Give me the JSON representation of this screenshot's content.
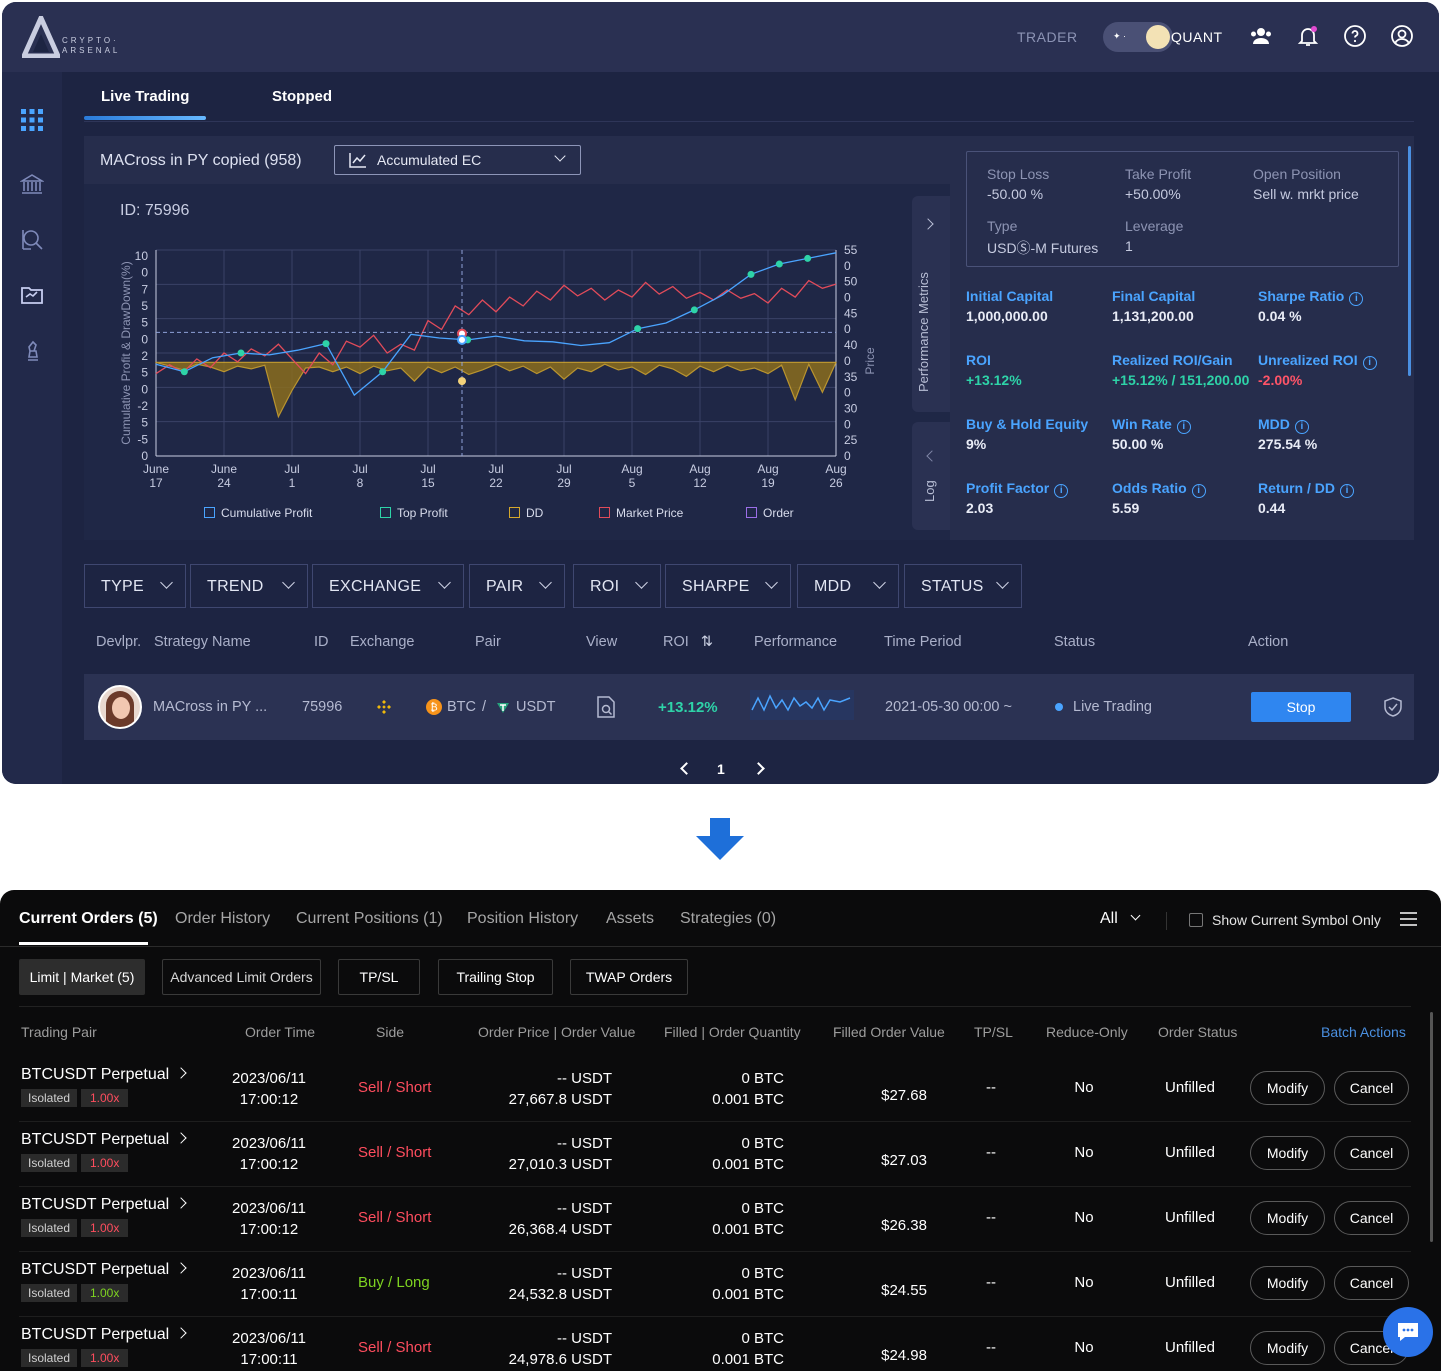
{
  "app": {
    "logo_line1": "CRYPTO·",
    "logo_line2": "ARSENAL",
    "mode_left": "TRADER",
    "mode_right": "QUANT"
  },
  "tabs": [
    "Live Trading",
    "Stopped"
  ],
  "chart_panel": {
    "strategy_title": "MACross in PY copied (958)",
    "view_select": "Accumulated EC",
    "id_label": "ID: 75996",
    "side_tab_metrics": "Performance Metrics",
    "side_tab_log": "Log"
  },
  "chart_data": {
    "type": "line",
    "ylabel": "Cumulative Profit & DrawDown(%)",
    "y2label": "Price",
    "left_ticks": [
      "10",
      "0",
      "7",
      "5",
      "5",
      "0",
      "2",
      "5",
      "0",
      "-2",
      "5",
      "-5",
      "0"
    ],
    "right_ticks": [
      "55",
      "0",
      "50",
      "0",
      "45",
      "0",
      "40",
      "0",
      "35",
      "0",
      "30",
      "0",
      "25",
      "0"
    ],
    "x_ticks": [
      [
        "June",
        "17"
      ],
      [
        "June",
        "24"
      ],
      [
        "Jul",
        "1"
      ],
      [
        "Jul",
        "8"
      ],
      [
        "Jul",
        "15"
      ],
      [
        "Jul",
        "22"
      ],
      [
        "Jul",
        "29"
      ],
      [
        "Aug",
        "5"
      ],
      [
        "Aug",
        "12"
      ],
      [
        "Aug",
        "19"
      ],
      [
        "Aug",
        "26"
      ]
    ],
    "legend": [
      "Cumulative Profit",
      "Top Profit",
      "DD",
      "Market Price",
      "Order"
    ],
    "cumulative_profit": [
      -0.2,
      -1,
      0.5,
      1,
      0.8,
      1.3,
      2,
      -3.5,
      -1,
      3,
      2.6,
      2.4,
      2.8,
      2.3,
      2.2,
      1.8,
      2.1,
      3.6,
      4.2,
      5.6,
      7.2,
      9.4,
      10.5,
      11.1,
      11.7
    ],
    "drawdown": [
      0,
      -0.4,
      -0.8,
      -0.2,
      -0.5,
      -1,
      -0.4,
      -0.7,
      -0.3,
      -5.8,
      -3,
      -0.6,
      -0.5,
      -1,
      -0.5,
      -1.2,
      -0.4,
      -0.9,
      -0.6,
      -2,
      -0.5,
      -1.1,
      -0.5,
      -1.3,
      -0.8,
      -0.2,
      -0.9,
      -0.4,
      -1.2,
      -0.5,
      -1.8,
      -0.6,
      -1,
      -0.2,
      -0.8,
      -0.5,
      -1.3,
      -0.3,
      -0.7,
      -1.5,
      -0.4,
      -1,
      -0.3,
      -0.9,
      -0.6,
      -1.2,
      -0.3,
      -4,
      -0.2,
      -3.2,
      0
    ],
    "market_price": [
      34,
      35.5,
      34.2,
      36.5,
      35,
      37.5,
      36,
      38.2,
      37,
      39,
      36.5,
      34,
      37.5,
      35.5,
      39.5,
      38.5,
      40.5,
      37.5,
      39,
      38,
      43,
      41.5,
      45.5,
      44,
      46.5,
      44.5,
      47,
      45.5,
      48,
      46.5,
      49,
      47.2,
      48.5,
      46.5,
      48.2,
      47,
      49.5,
      47.5,
      48.8,
      46.8,
      47.8,
      46.5,
      48.2,
      46.8,
      47.6,
      46,
      48.5,
      47,
      49.8,
      48.5,
      49.2
    ],
    "ylim": [
      -10,
      12
    ],
    "y2lim": [
      20,
      55
    ]
  },
  "metrics": {
    "box": [
      {
        "label": "Stop Loss",
        "value": "-50.00 %"
      },
      {
        "label": "Take Profit",
        "value": "+50.00%"
      },
      {
        "label": "Open Position",
        "value": "Sell w. mrkt price"
      },
      {
        "label": "Type",
        "value": "USDⓈ-M Futures"
      },
      {
        "label": "Leverage",
        "value": "1"
      }
    ],
    "grid": [
      {
        "label": "Initial Capital",
        "value": "1,000,000.00",
        "color": "#e9ecf6"
      },
      {
        "label": "Final Capital",
        "value": "1,131,200.00",
        "color": "#e9ecf6"
      },
      {
        "label": "Sharpe Ratio",
        "value": "0.04 %",
        "color": "#e9ecf6"
      },
      {
        "label": "ROI",
        "value": "+13.12%",
        "color": "#2ed3a8"
      },
      {
        "label": "Realized ROI/Gain",
        "value": "+15.12% / 151,200.00",
        "color": "#2ed3a8"
      },
      {
        "label": "Unrealized ROI",
        "value": "-2.00%",
        "color": "#ff5468"
      },
      {
        "label": "Buy & Hold Equity",
        "value": "9%",
        "color": "#e9ecf6"
      },
      {
        "label": "Win Rate",
        "value": "50.00 %",
        "color": "#e9ecf6"
      },
      {
        "label": "MDD",
        "value": "275.54 %",
        "color": "#e9ecf6"
      },
      {
        "label": "Profit Factor",
        "value": "2.03",
        "color": "#e9ecf6"
      },
      {
        "label": "Odds Ratio",
        "value": "5.59",
        "color": "#e9ecf6"
      },
      {
        "label": "Return / DD",
        "value": "0.44",
        "color": "#e9ecf6"
      }
    ]
  },
  "filters": [
    "TYPE",
    "TREND",
    "EXCHANGE",
    "PAIR",
    "ROI",
    "SHARPE",
    "MDD",
    "STATUS"
  ],
  "table_headers": [
    "Devlpr.",
    "Strategy Name",
    "ID",
    "Exchange",
    "Pair",
    "View",
    "ROI",
    "Performance",
    "Time Period",
    "Status",
    "Action"
  ],
  "strategy_row": {
    "name": "MACross in PY ...",
    "id": "75996",
    "pair_base": "BTC",
    "pair_sep": "/",
    "pair_quote": "USDT",
    "roi": "+13.12%",
    "time_period": "2021-05-30 00:00 ~",
    "status": "Live Trading",
    "action": "Stop"
  },
  "pager": {
    "page": "1"
  },
  "orders_panel": {
    "tabs": [
      "Current Orders (5)",
      "Order History",
      "Current Positions (1)",
      "Position History",
      "Assets",
      "Strategies (0)"
    ],
    "filter_all": "All",
    "show_current_symbol": "Show Current Symbol Only",
    "subtabs": [
      "Limit | Market (5)",
      "Advanced Limit Orders",
      "TP/SL",
      "Trailing Stop",
      "TWAP Orders"
    ],
    "headers": [
      "Trading Pair",
      "Order Time",
      "Side",
      "Order Price | Order Value",
      "Filled | Order Quantity",
      "Filled Order Value",
      "TP/SL",
      "Reduce-Only",
      "Order Status",
      "Batch Actions"
    ],
    "rows": [
      {
        "pair": "BTCUSDT Perpetual",
        "margin": "Isolated",
        "leverage": "1.00x",
        "date": "2023/06/11",
        "time": "17:00:12",
        "side": "Sell / Short",
        "price": "-- USDT",
        "value": "27,667.8 USDT",
        "filled": "0 BTC",
        "qty": "0.001 BTC",
        "filled_value": "$27.68",
        "tpsl": "--",
        "reduce": "No",
        "status": "Unfilled",
        "modify": "Modify",
        "cancel": "Cancel"
      },
      {
        "pair": "BTCUSDT Perpetual",
        "margin": "Isolated",
        "leverage": "1.00x",
        "date": "2023/06/11",
        "time": "17:00:12",
        "side": "Sell / Short",
        "price": "-- USDT",
        "value": "27,010.3 USDT",
        "filled": "0 BTC",
        "qty": "0.001 BTC",
        "filled_value": "$27.03",
        "tpsl": "--",
        "reduce": "No",
        "status": "Unfilled",
        "modify": "Modify",
        "cancel": "Cancel"
      },
      {
        "pair": "BTCUSDT Perpetual",
        "margin": "Isolated",
        "leverage": "1.00x",
        "date": "2023/06/11",
        "time": "17:00:12",
        "side": "Sell / Short",
        "price": "-- USDT",
        "value": "26,368.4 USDT",
        "filled": "0 BTC",
        "qty": "0.001 BTC",
        "filled_value": "$26.38",
        "tpsl": "--",
        "reduce": "No",
        "status": "Unfilled",
        "modify": "Modify",
        "cancel": "Cancel"
      },
      {
        "pair": "BTCUSDT Perpetual",
        "margin": "Isolated",
        "leverage": "1.00x",
        "date": "2023/06/11",
        "time": "17:00:11",
        "side": "Buy / Long",
        "price": "-- USDT",
        "value": "24,532.8 USDT",
        "filled": "0 BTC",
        "qty": "0.001 BTC",
        "filled_value": "$24.55",
        "tpsl": "--",
        "reduce": "No",
        "status": "Unfilled",
        "modify": "Modify",
        "cancel": "Cancel"
      },
      {
        "pair": "BTCUSDT Perpetual",
        "margin": "Isolated",
        "leverage": "1.00x",
        "date": "2023/06/11",
        "time": "17:00:11",
        "side": "Sell / Short",
        "price": "-- USDT",
        "value": "24,978.6 USDT",
        "filled": "0 BTC",
        "qty": "0.001 BTC",
        "filled_value": "$24.98",
        "tpsl": "--",
        "reduce": "No",
        "status": "Unfilled",
        "modify": "Modify",
        "cancel": "Cancel"
      }
    ]
  },
  "colors": {
    "accent": "#2f86f0",
    "profit": "#2ed3a8",
    "loss": "#ff5468",
    "sell": "#ff4d5e",
    "buy": "#7ed321",
    "dd": "#d4a72c",
    "price": "#e14b5a",
    "cum": "#4aa4ff"
  }
}
